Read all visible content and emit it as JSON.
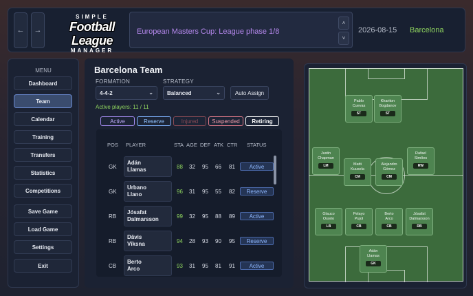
{
  "header": {
    "back_label": "←",
    "forward_label": "→",
    "logo": {
      "line1": "SIMPLE",
      "line2": "Football League",
      "line3": "MANAGER"
    },
    "news": "European Masters Cup: League phase 1/8",
    "news_up": "˄",
    "news_down": "˅",
    "date": "2026-08-15",
    "club": "Barcelona"
  },
  "menu": {
    "title": "MENU",
    "items": [
      "Dashboard",
      "Team",
      "Calendar",
      "Training",
      "Transfers",
      "Statistics",
      "Competitions",
      "Save Game",
      "Load Game",
      "Settings",
      "Exit"
    ],
    "active": "Team"
  },
  "team": {
    "title": "Barcelona Team",
    "formation_label": "FORMATION",
    "formation_value": "4-4-2",
    "strategy_label": "STRATEGY",
    "strategy_value": "Balanced",
    "auto_assign": "Auto Assign",
    "active_players": "Active players: 11 / 11",
    "filters": [
      "Active",
      "Reserve",
      "Injured",
      "Suspended",
      "Retiring"
    ],
    "columns": [
      "POS",
      "PLAYER",
      "STA",
      "AGE",
      "DEF",
      "ATK",
      "CTR",
      "STATUS"
    ],
    "rows": [
      {
        "pos": "GK",
        "name1": "Adán",
        "name2": "Llamas",
        "sta": "88",
        "age": "32",
        "def": "95",
        "atk": "66",
        "ctr": "81",
        "status": "Active"
      },
      {
        "pos": "GK",
        "name1": "Urbano",
        "name2": "Llano",
        "sta": "96",
        "age": "31",
        "def": "95",
        "atk": "55",
        "ctr": "82",
        "status": "Reserve"
      },
      {
        "pos": "RB",
        "name1": "Jósafat",
        "name2": "Dalmarsson",
        "sta": "99",
        "age": "32",
        "def": "95",
        "atk": "88",
        "ctr": "89",
        "status": "Active"
      },
      {
        "pos": "RB",
        "name1": "Dāvis",
        "name2": "Vīksna",
        "sta": "94",
        "age": "28",
        "def": "93",
        "atk": "90",
        "ctr": "95",
        "status": "Reserve"
      },
      {
        "pos": "CB",
        "name1": "Berto",
        "name2": "Arco",
        "sta": "93",
        "age": "31",
        "def": "95",
        "atk": "81",
        "ctr": "91",
        "status": "Active"
      }
    ]
  },
  "pitch": {
    "players": [
      {
        "n1": "Pablo",
        "n2": "Cuevas",
        "pos": "ST"
      },
      {
        "n1": "Khariton",
        "n2": "Bogdanov",
        "pos": "ST"
      },
      {
        "n1": "Justin",
        "n2": "Chapman",
        "pos": "LM"
      },
      {
        "n1": "Matti",
        "n2": "Kuusela",
        "pos": "CM"
      },
      {
        "n1": "Alejandro",
        "n2": "Gómez",
        "pos": "CM"
      },
      {
        "n1": "Rafael",
        "n2": "Simões",
        "pos": "RW"
      },
      {
        "n1": "Glauco",
        "n2": "Osorio",
        "pos": "LB"
      },
      {
        "n1": "Pelayo",
        "n2": "Pujol",
        "pos": "CB"
      },
      {
        "n1": "Berto",
        "n2": "Arco",
        "pos": "CB"
      },
      {
        "n1": "Jósafat",
        "n2": "Dalmarsson",
        "pos": "RB"
      },
      {
        "n1": "Adán",
        "n2": "Llamas",
        "pos": "GK"
      }
    ]
  },
  "colors": {
    "accent_green": "#8fd45f",
    "news_purple": "#b88af0",
    "filter_active": "#a48cf0",
    "filter_reserve": "#7fb2ff",
    "filter_injured": "#8a4a55",
    "filter_suspended": "#e07a8a",
    "filter_retiring": "#ffffff"
  }
}
